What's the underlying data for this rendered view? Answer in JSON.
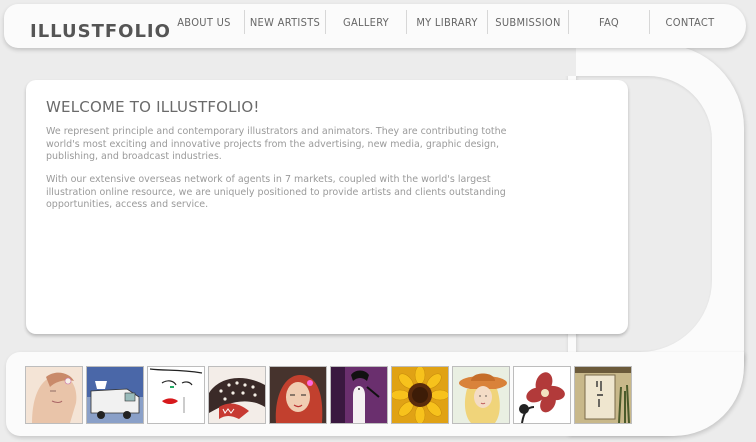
{
  "brand": {
    "logo_text": "ILLUSTFOLIO"
  },
  "nav": {
    "items": [
      {
        "label": "ABOUT US",
        "name": "nav-about-us"
      },
      {
        "label": "NEW ARTISTS",
        "name": "nav-new-artists"
      },
      {
        "label": "GALLERY",
        "name": "nav-gallery"
      },
      {
        "label": "MY LIBRARY",
        "name": "nav-my-library"
      },
      {
        "label": "SUBMISSION",
        "name": "nav-submission"
      },
      {
        "label": "FAQ",
        "name": "nav-faq"
      },
      {
        "label": "CONTACT",
        "name": "nav-contact"
      }
    ]
  },
  "welcome": {
    "title": "WELCOME TO ILLUSTFOLIO!",
    "paragraph1": "We represent principle and contemporary illustrators and animators. They are contributing tothe world's most exciting and innovative projects from the advertising, new media, graphic design, publishing, and broadcast industries.",
    "paragraph2": "With our extensive overseas network of agents in 7 markets, coupled with the world's largest illustration online resource, we are uniquely positioned to provide artists and clients outstanding opportunities, access and service."
  },
  "thumbnails": [
    {
      "name": "thumb-woman-portrait",
      "icon": "illustration-thumbnail"
    },
    {
      "name": "thumb-truck",
      "icon": "illustration-thumbnail"
    },
    {
      "name": "thumb-red-lips-face",
      "icon": "illustration-thumbnail"
    },
    {
      "name": "thumb-creature",
      "icon": "illustration-thumbnail"
    },
    {
      "name": "thumb-red-hair-girl",
      "icon": "illustration-thumbnail"
    },
    {
      "name": "thumb-purple-figure",
      "icon": "illustration-thumbnail"
    },
    {
      "name": "thumb-sunflower",
      "icon": "illustration-thumbnail"
    },
    {
      "name": "thumb-hat-woman",
      "icon": "illustration-thumbnail"
    },
    {
      "name": "thumb-flower-figure",
      "icon": "illustration-thumbnail"
    },
    {
      "name": "thumb-scroll-painting",
      "icon": "illustration-thumbnail"
    }
  ]
}
